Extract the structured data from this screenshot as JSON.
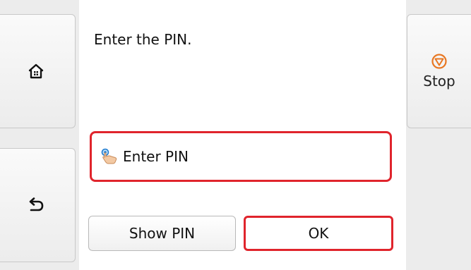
{
  "instruction": "Enter the PIN.",
  "stop": {
    "label": "Stop",
    "icon": "stop-icon",
    "icon_color": "#e87722"
  },
  "home": {
    "icon": "home-icon"
  },
  "back": {
    "icon": "back-icon"
  },
  "pin_field": {
    "label": "Enter PIN",
    "icon": "touch-icon",
    "border_color": "#e0242c"
  },
  "buttons": {
    "show_pin": "Show PIN",
    "ok": "OK"
  }
}
